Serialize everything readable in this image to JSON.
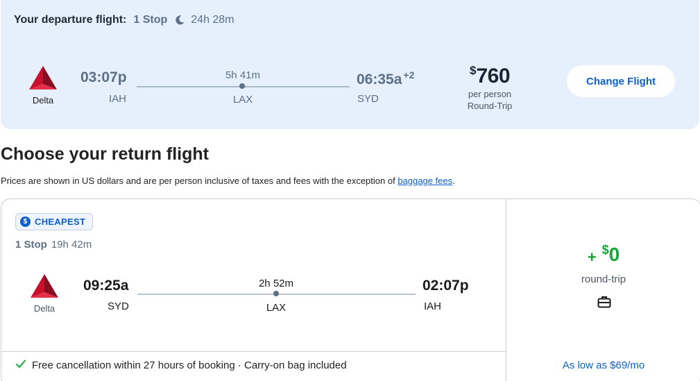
{
  "departure": {
    "label": "Your departure flight:",
    "stops": "1 Stop",
    "icon": "moon-icon",
    "duration": "24h 28m",
    "airline": "Delta",
    "depart_time": "03:07p",
    "depart_code": "IAH",
    "leg_duration": "5h 41m",
    "stop_code": "LAX",
    "arrive_time": "06:35a",
    "arrive_offset": "+2",
    "arrive_code": "SYD",
    "currency": "$",
    "price": "760",
    "price_sub1": "per person",
    "price_sub2": "Round-Trip",
    "change_button": "Change Flight"
  },
  "return_section": {
    "title": "Choose your return flight",
    "note_prefix": "Prices are shown in US dollars and are per person inclusive of taxes and fees with the exception of ",
    "note_link": "baggage fees",
    "note_suffix": "."
  },
  "return_flight": {
    "badge": "CHEAPEST",
    "badge_icon": "dollar-coin-icon",
    "stops": "1 Stop",
    "duration": "19h 42m",
    "airline": "Delta",
    "depart_time": "09:25a",
    "depart_code": "SYD",
    "leg_duration": "2h 52m",
    "stop_code": "LAX",
    "arrive_time": "02:07p",
    "arrive_code": "IAH",
    "add_sign": "+",
    "add_currency": "$",
    "add_price": "0",
    "price_type": "round-trip",
    "bag_icon": "briefcase-icon",
    "footer_icon": "checkmark-icon",
    "footer_text": "Free cancellation within 27 hours of booking · Carry-on bag included",
    "financing": "As low as $69/mo"
  },
  "colors": {
    "brand_blue": "#0b5fcf",
    "departure_bg": "#e6f0fd",
    "delta_red": "#c8102e",
    "green": "#1aa53a",
    "slate": "#5b6f88"
  }
}
